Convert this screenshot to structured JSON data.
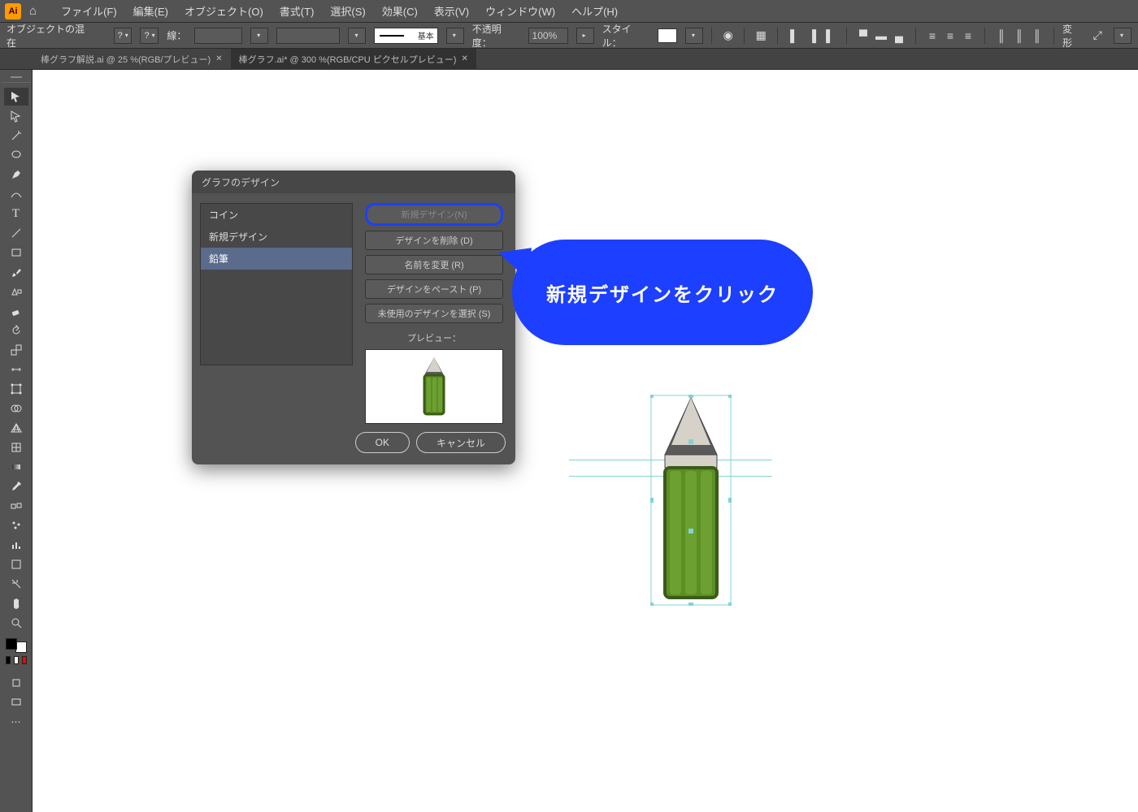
{
  "menubar": {
    "items": [
      "ファイル(F)",
      "編集(E)",
      "オブジェクト(O)",
      "書式(T)",
      "選択(S)",
      "効果(C)",
      "表示(V)",
      "ウィンドウ(W)",
      "ヘルプ(H)"
    ]
  },
  "controlbar": {
    "mode": "オブジェクトの混在",
    "q1": "?",
    "q2": "?",
    "stroke_label": "線：",
    "brush_label": "基本",
    "opacity_label": "不透明度：",
    "opacity_value": "100%",
    "style_label": "スタイル：",
    "transform_label": "変形"
  },
  "tabs": [
    {
      "label": "棒グラフ解説.ai @ 25 %(RGB/プレビュー)"
    },
    {
      "label": "棒グラフ.ai* @ 300 %(RGB/CPU ピクセルプレビュー)"
    }
  ],
  "dialog": {
    "title": "グラフのデザイン",
    "list": [
      "コイン",
      "新規デザイン",
      "鉛筆"
    ],
    "selected_index": 2,
    "buttons": {
      "new": "新規デザイン(N)",
      "del": "デザインを削除 (D)",
      "rename": "名前を変更 (R)",
      "paste": "デザインをペースト (P)",
      "select_unused": "未使用のデザインを選択 (S)"
    },
    "preview_label": "プレビュー：",
    "ok": "OK",
    "cancel": "キャンセル"
  },
  "callout": {
    "text": "新規デザインをクリック"
  }
}
